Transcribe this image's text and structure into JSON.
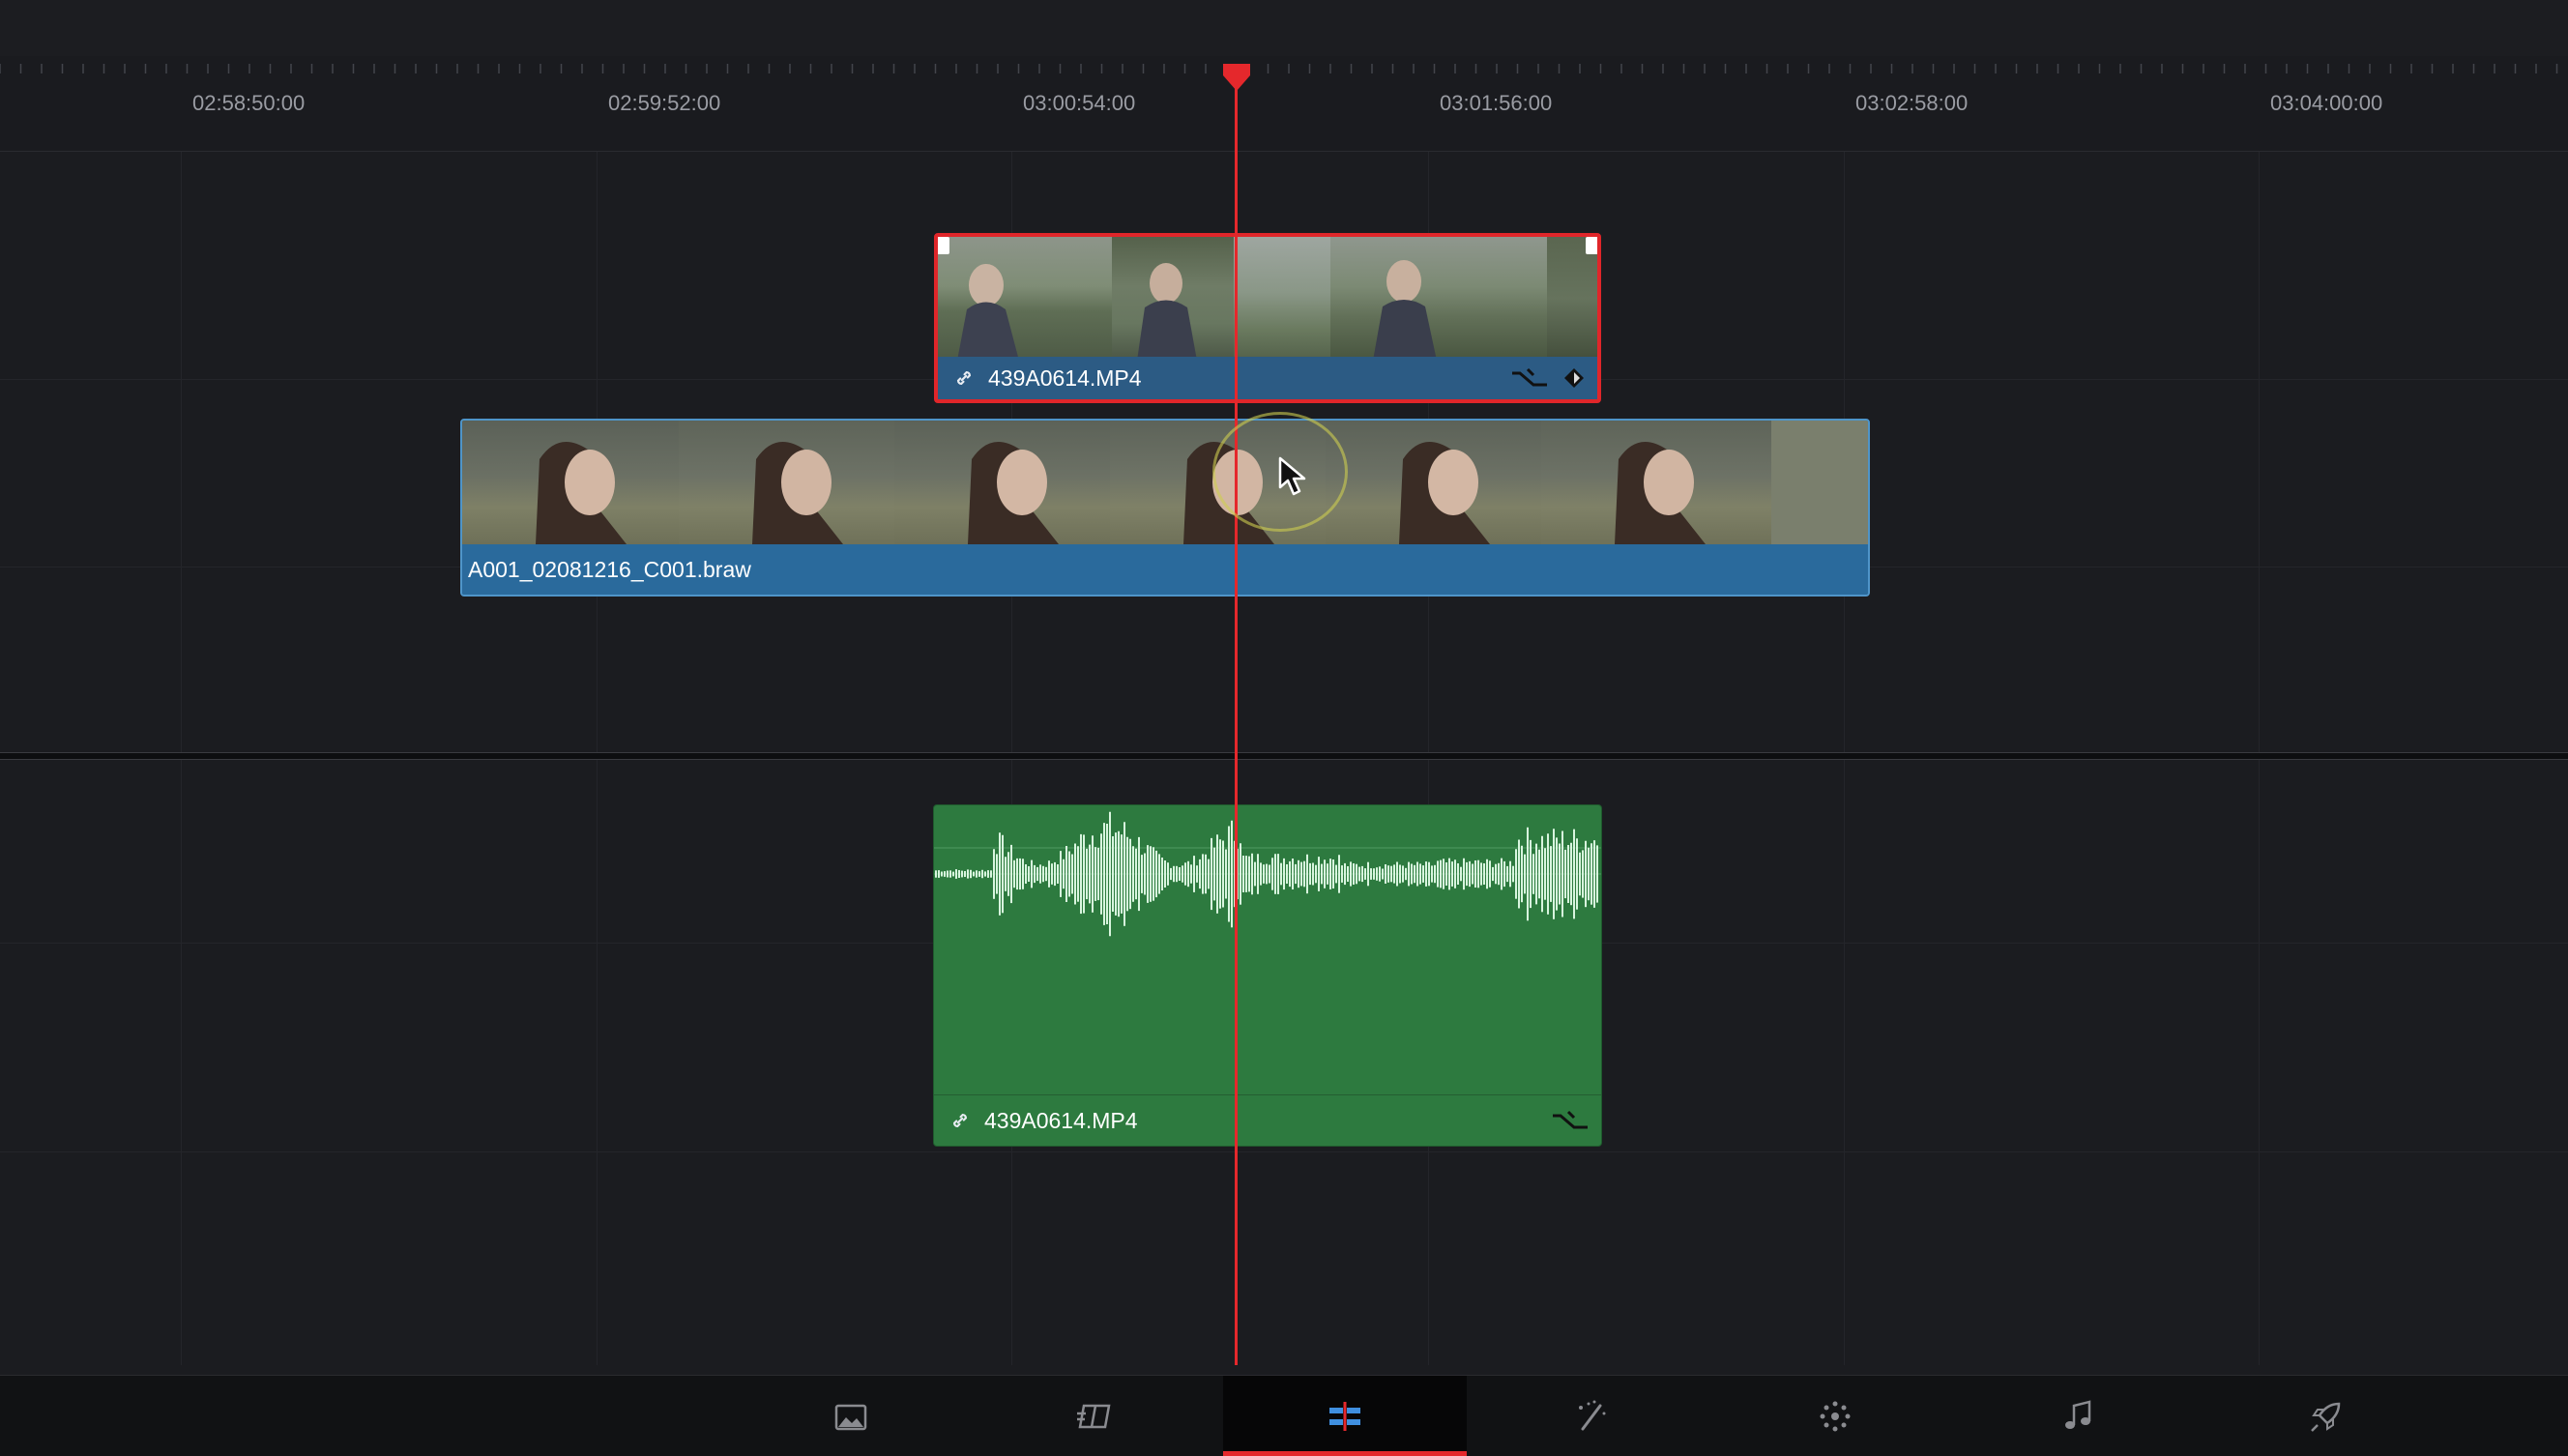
{
  "timeline": {
    "ruler": {
      "timecodes": [
        "02:58:50:00",
        "02:59:52:00",
        "03:00:54:00",
        "03:01:56:00",
        "03:02:58:00",
        "03:04:00:00"
      ]
    },
    "clips": {
      "video_top": {
        "name": "439A0614.MP4",
        "selected": true,
        "linked": true
      },
      "video_main": {
        "name": "A001_02081216_C001.braw"
      },
      "audio": {
        "name": "439A0614.MP4",
        "linked": true
      }
    }
  },
  "page_bar": {
    "pages": [
      {
        "name": "media",
        "icon": "media-icon"
      },
      {
        "name": "cut",
        "icon": "cut-icon"
      },
      {
        "name": "edit",
        "icon": "edit-icon",
        "active": true
      },
      {
        "name": "fusion",
        "icon": "fusion-icon"
      },
      {
        "name": "color",
        "icon": "color-icon"
      },
      {
        "name": "fairlight",
        "icon": "music-note-icon"
      },
      {
        "name": "deliver",
        "icon": "rocket-icon"
      }
    ]
  },
  "colors": {
    "playhead": "#e5282c",
    "video_clip": "#2a6a9c",
    "audio_clip": "#2d7a3f",
    "selection": "#e0262a"
  }
}
